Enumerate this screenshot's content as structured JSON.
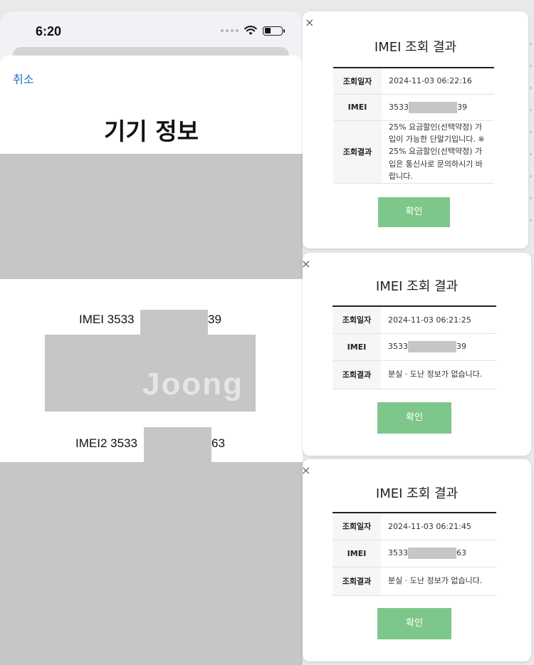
{
  "status_bar": {
    "time": "6:20"
  },
  "sheet": {
    "cancel_label": "취소",
    "title": "기기 정보",
    "imei1_prefix": "IMEI 3533",
    "imei1_suffix": "39",
    "imei2_prefix": "IMEI2 3533",
    "imei2_suffix": "63",
    "watermark": "Joong"
  },
  "dialogs": [
    {
      "close": "×",
      "title": "IMEI 조회 결과",
      "date_label": "조회일자",
      "date_value": "2024-11-03 06:22:16",
      "imei_label": "IMEI",
      "imei_prefix": "3533",
      "imei_suffix": "39",
      "result_label": "조회결과",
      "result_value": "25% 요금할인(선택약정) 가입이 가능한 단말기입니다. ※ 25% 요금할인(선택약정) 가입은 통신사로 문의하시기 바랍니다.",
      "confirm": "확인"
    },
    {
      "close": "×",
      "title": "IMEI 조회 결과",
      "date_label": "조회일자",
      "date_value": "2024-11-03 06:21:25",
      "imei_label": "IMEI",
      "imei_prefix": "3533",
      "imei_suffix": "39",
      "result_label": "조회결과",
      "result_value": "분실 · 도난 정보가 없습니다.",
      "confirm": "확인"
    },
    {
      "close": "×",
      "title": "IMEI 조회 결과",
      "date_label": "조회일자",
      "date_value": "2024-11-03 06:21:45",
      "imei_label": "IMEI",
      "imei_prefix": "3533",
      "imei_suffix": "63",
      "result_label": "조회결과",
      "result_value": "분실 · 도난 정보가 없습니다.",
      "confirm": "확인"
    }
  ],
  "colors": {
    "link": "#1f6fcf",
    "button": "#7ec78b",
    "redaction": "#c6c6c6"
  }
}
